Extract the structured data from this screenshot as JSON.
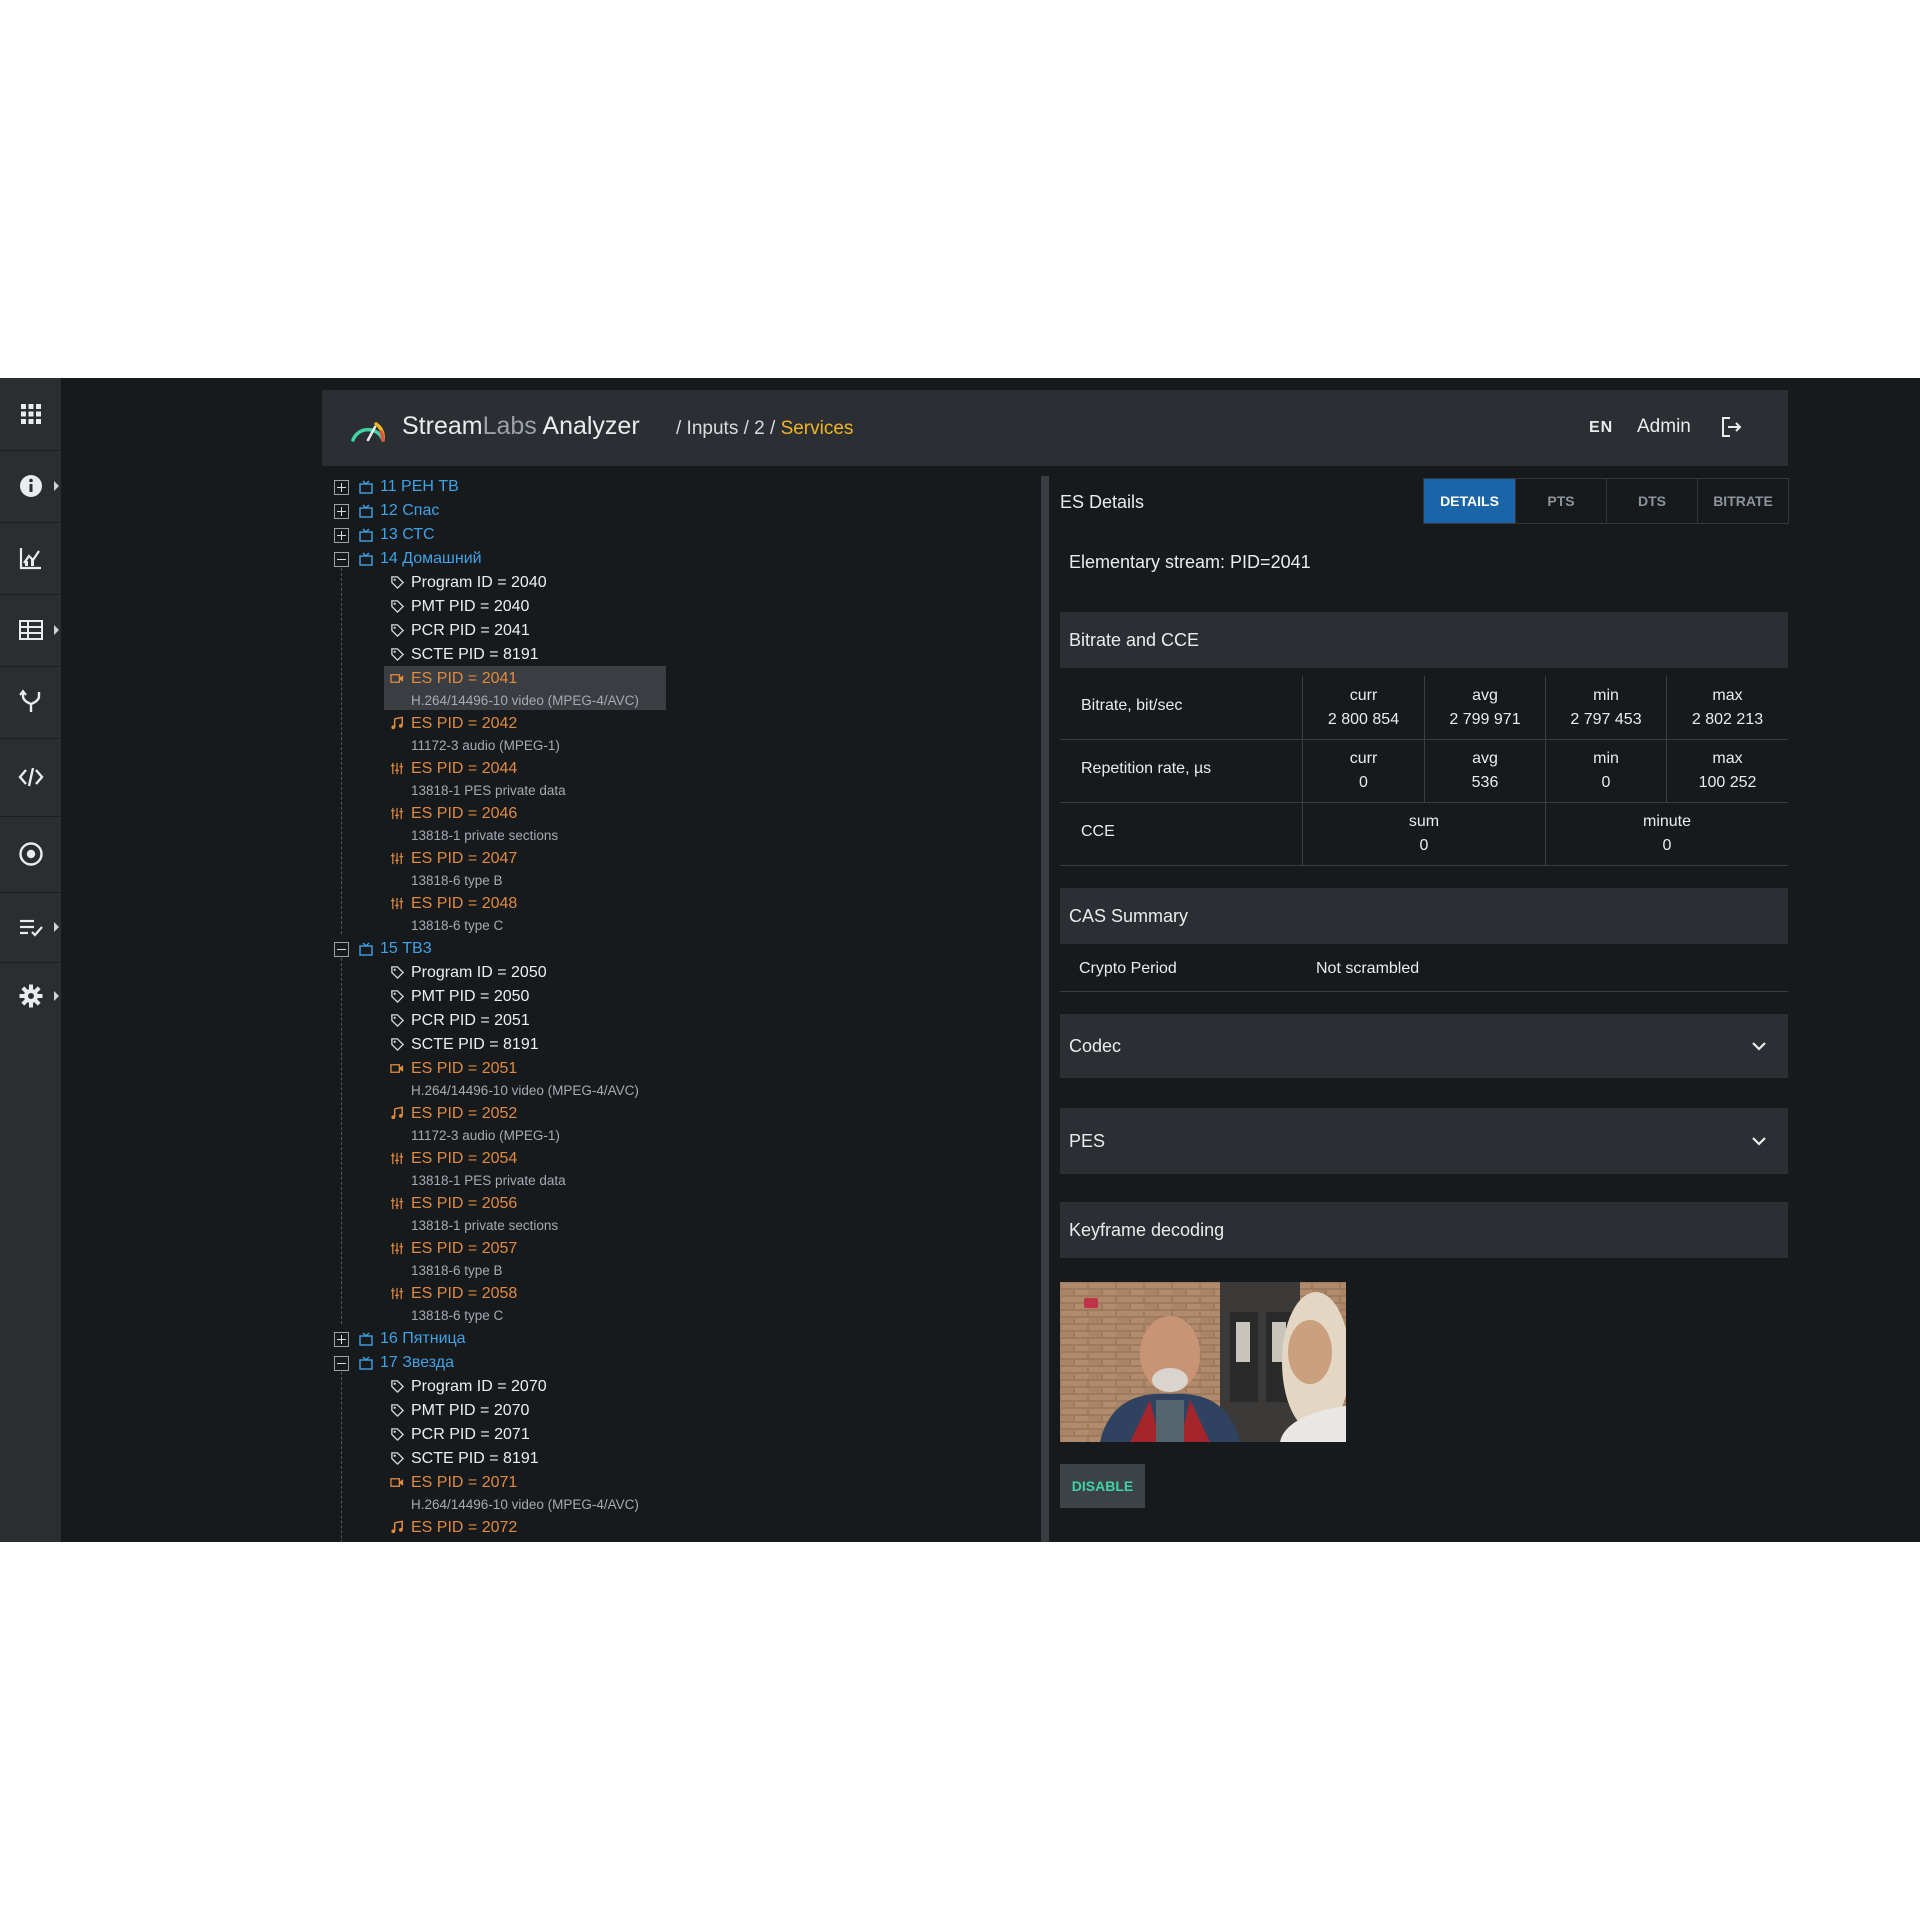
{
  "header": {
    "brand_stream": "Stream",
    "brand_labs": "Labs",
    "brand_analyzer": "Analyzer",
    "crumb_prefix": "/ Inputs / 2 /",
    "crumb_active": "Services",
    "lang": "EN",
    "user": "Admin"
  },
  "rail": {
    "icons": [
      "apps-grid-icon",
      "info-icon",
      "chart-icon",
      "table-icon",
      "fork-icon",
      "code-icon",
      "record-icon",
      "checklist-icon",
      "gear-icon"
    ]
  },
  "tree": {
    "services": [
      {
        "label": "11 РЕН ТВ",
        "expanded": false
      },
      {
        "label": "12 Спас",
        "expanded": false
      },
      {
        "label": "13 СТС",
        "expanded": false
      },
      {
        "label": "14 Домашний",
        "expanded": true,
        "props": [
          "Program ID = 2040",
          "PMT PID = 2040",
          "PCR PID = 2041",
          "SCTE PID = 8191"
        ],
        "es": [
          {
            "label": "ES PID = 2041",
            "sub": "H.264/14496-10 video (MPEG-4/AVC)",
            "kind": "video",
            "selected": true
          },
          {
            "label": "ES PID = 2042",
            "sub": "11172-3 audio (MPEG-1)",
            "kind": "audio"
          },
          {
            "label": "ES PID = 2044",
            "sub": "13818-1 PES private data",
            "kind": "data"
          },
          {
            "label": "ES PID = 2046",
            "sub": "13818-1 private sections",
            "kind": "data"
          },
          {
            "label": "ES PID = 2047",
            "sub": "13818-6 type B",
            "kind": "data"
          },
          {
            "label": "ES PID = 2048",
            "sub": "13818-6 type C",
            "kind": "data"
          }
        ]
      },
      {
        "label": "15 ТВ3",
        "expanded": true,
        "props": [
          "Program ID = 2050",
          "PMT PID = 2050",
          "PCR PID = 2051",
          "SCTE PID = 8191"
        ],
        "es": [
          {
            "label": "ES PID = 2051",
            "sub": "H.264/14496-10 video (MPEG-4/AVC)",
            "kind": "video"
          },
          {
            "label": "ES PID = 2052",
            "sub": "11172-3 audio (MPEG-1)",
            "kind": "audio"
          },
          {
            "label": "ES PID = 2054",
            "sub": "13818-1 PES private data",
            "kind": "data"
          },
          {
            "label": "ES PID = 2056",
            "sub": "13818-1 private sections",
            "kind": "data"
          },
          {
            "label": "ES PID = 2057",
            "sub": "13818-6 type B",
            "kind": "data"
          },
          {
            "label": "ES PID = 2058",
            "sub": "13818-6 type C",
            "kind": "data"
          }
        ]
      },
      {
        "label": "16 Пятница",
        "expanded": false
      },
      {
        "label": "17 Звезда",
        "expanded": true,
        "props": [
          "Program ID = 2070",
          "PMT PID = 2070",
          "PCR PID = 2071",
          "SCTE PID = 8191"
        ],
        "es": [
          {
            "label": "ES PID = 2071",
            "sub": "H.264/14496-10 video (MPEG-4/AVC)",
            "kind": "video"
          },
          {
            "label": "ES PID = 2072",
            "sub": "",
            "kind": "audio"
          }
        ]
      }
    ]
  },
  "details": {
    "title": "ES Details",
    "tabs": [
      "DETAILS",
      "PTS",
      "DTS",
      "BITRATE"
    ],
    "active_tab": "DETAILS",
    "es_title": "Elementary stream: PID=2041",
    "bitrate_section": "Bitrate and CCE",
    "bitrate_row": {
      "label": "Bitrate, bit/sec",
      "cells": [
        [
          "curr",
          "2 800 854"
        ],
        [
          "avg",
          "2 799 971"
        ],
        [
          "min",
          "2 797 453"
        ],
        [
          "max",
          "2 802 213"
        ]
      ]
    },
    "repetition_row": {
      "label": "Repetition rate, µs",
      "cells": [
        [
          "curr",
          "0"
        ],
        [
          "avg",
          "536"
        ],
        [
          "min",
          "0"
        ],
        [
          "max",
          "100 252"
        ]
      ]
    },
    "cce_row": {
      "label": "CCE",
      "cells": [
        [
          "sum",
          "0"
        ],
        [
          "minute",
          "0"
        ]
      ]
    },
    "cas_section": "CAS Summary",
    "cas_label": "Crypto Period",
    "cas_value": "Not scrambled",
    "codec_section": "Codec",
    "pes_section": "PES",
    "keyframe_section": "Keyframe decoding",
    "disable_button": "DISABLE"
  }
}
